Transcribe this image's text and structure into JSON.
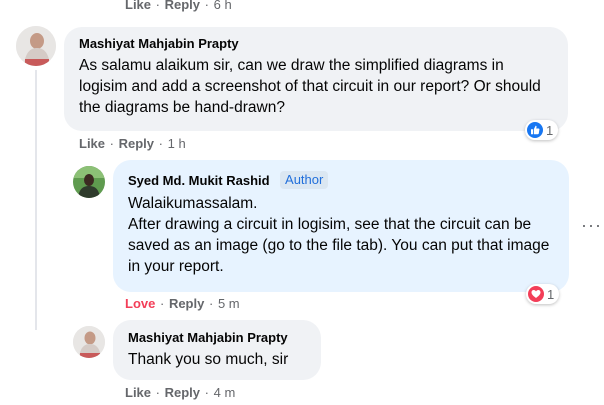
{
  "top_actions": {
    "like": "Like",
    "reply": "Reply",
    "time": "6 h"
  },
  "comment1": {
    "author": "Mashiyat Mahjabin Prapty",
    "text": "As salamu alaikum sir, can we draw the simplified diagrams in logisim and add a screenshot of that circuit in our report? Or should the diagrams be hand-drawn?",
    "like": "Like",
    "reply": "Reply",
    "time": "1 h",
    "reaction": {
      "type": "like",
      "count": "1",
      "color": "#1877f2"
    }
  },
  "reply1": {
    "author": "Syed Md. Mukit Rashid",
    "badge": "Author",
    "line1": "Walaikumassalam.",
    "line2": "After drawing a circuit in logisim, see that the circuit can be saved as an image (go to the file tab). You can put that image in your report.",
    "love": "Love",
    "reply": "Reply",
    "time": "5 m",
    "love_color": "#f33e58",
    "reaction": {
      "type": "love",
      "count": "1",
      "color": "#f33e58"
    }
  },
  "reply2": {
    "author": "Mashiyat Mahjabin Prapty",
    "text": "Thank you so much, sir",
    "like": "Like",
    "reply": "Reply",
    "time": "4 m"
  },
  "more_options_icon": "more-horizontal-icon"
}
